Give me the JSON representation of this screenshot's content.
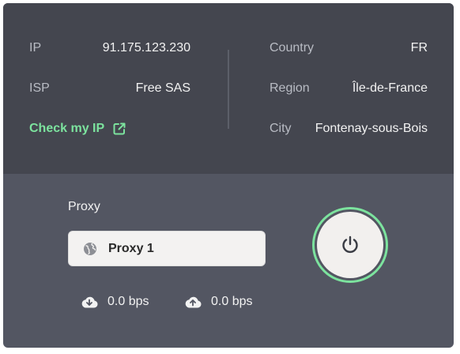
{
  "connection": {
    "ip_label": "IP",
    "ip_value": "91.175.123.230",
    "isp_label": "ISP",
    "isp_value": "Free SAS",
    "check_ip_label": "Check my IP",
    "country_label": "Country",
    "country_value": "FR",
    "region_label": "Region",
    "region_value": "Île-de-France",
    "city_label": "City",
    "city_value": "Fontenay-sous-Bois"
  },
  "proxy": {
    "label": "Proxy",
    "selected": "Proxy 1"
  },
  "traffic": {
    "download": "0.0 bps",
    "upload": "0.0 bps"
  },
  "icons": {
    "external_link": "external-link-icon",
    "globe": "globe-icon",
    "download": "cloud-download-icon",
    "upload": "cloud-upload-icon",
    "power": "power-icon"
  },
  "colors": {
    "accent": "#7ce39e",
    "info_panel_bg": "#44464f",
    "main_bg": "#535662",
    "button_bg": "#f2f0ee"
  }
}
